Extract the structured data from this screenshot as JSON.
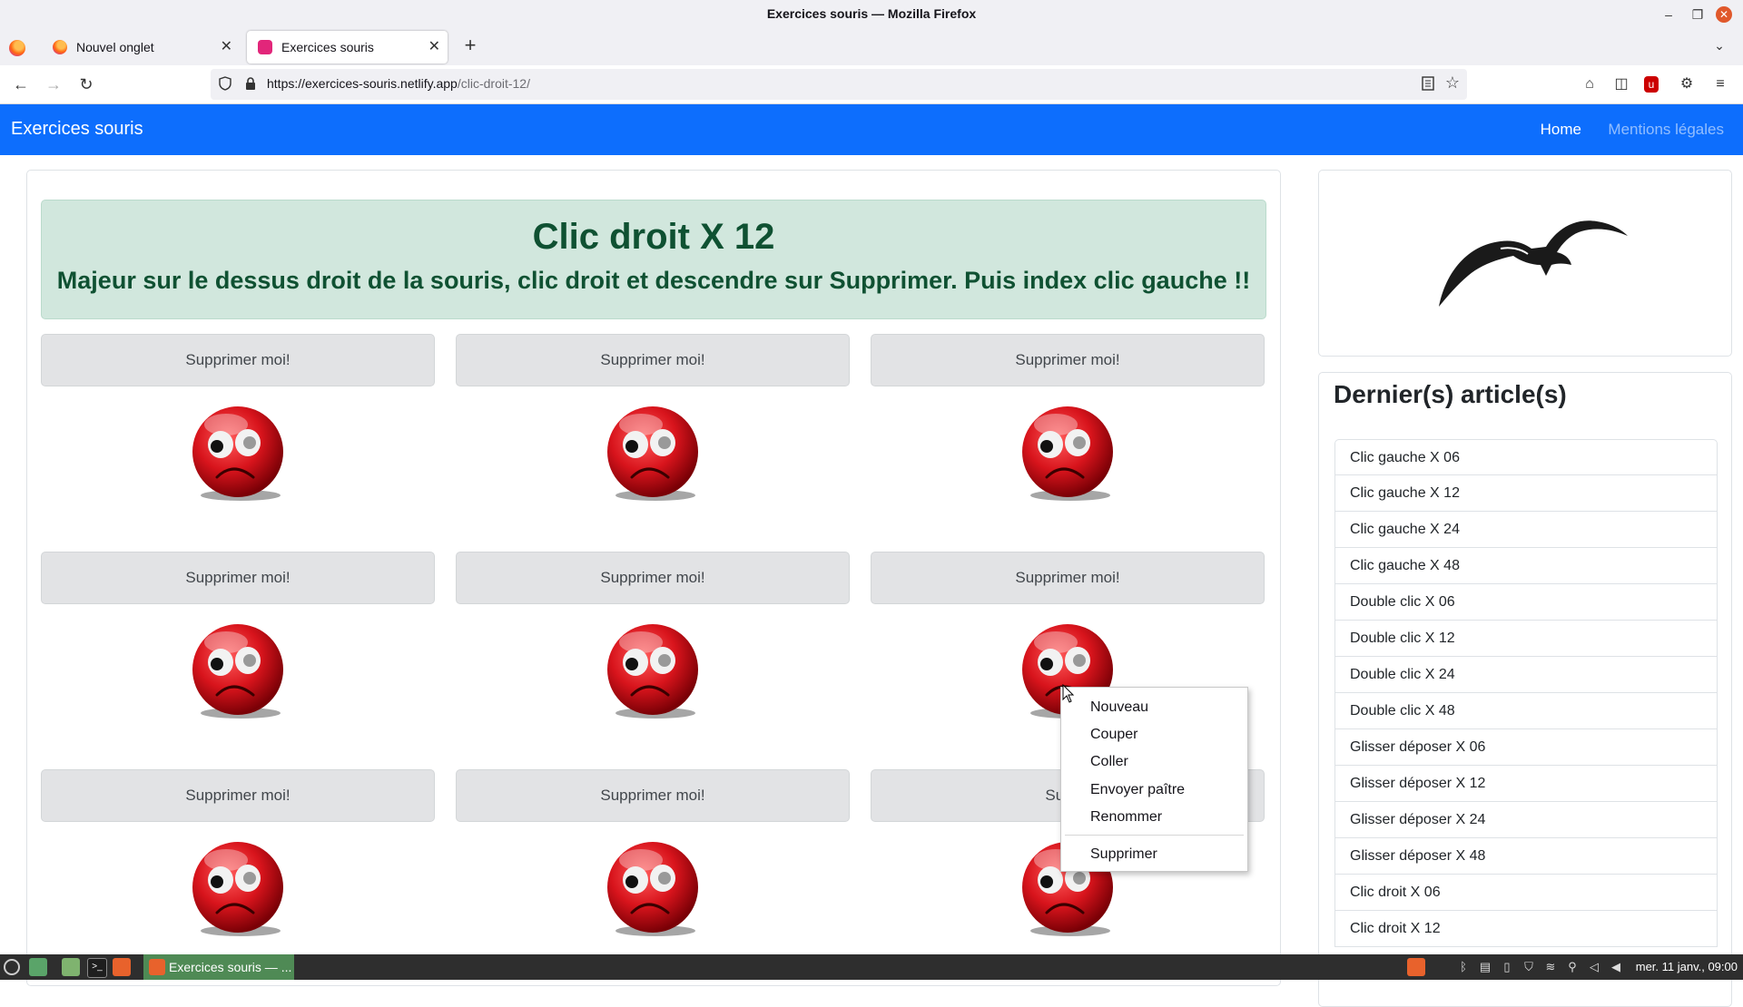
{
  "window": {
    "title": "Exercices souris — Mozilla Firefox"
  },
  "tabs": [
    {
      "label": "Nouvel onglet",
      "active": false
    },
    {
      "label": "Exercices souris",
      "active": true
    }
  ],
  "address": {
    "host": "https://exercices-souris.netlify.app",
    "path": "/clic-droit-12/"
  },
  "site": {
    "brand": "Exercices souris",
    "nav": {
      "home": "Home",
      "legal": "Mentions légales"
    }
  },
  "exercise": {
    "title": "Clic droit X 12",
    "instruction": "Majeur sur le dessus droit de la souris, clic droit et descendre sur Supprimer. Puis index clic gauche !!",
    "buttons": [
      "Supprimer moi!",
      "Supprimer moi!",
      "Supprimer moi!",
      "Supprimer moi!",
      "Supprimer moi!",
      "Supprimer moi!",
      "Supprimer moi!",
      "Supprimer moi!",
      "Suppri"
    ]
  },
  "sidebar": {
    "articles_title": "Dernier(s) article(s)",
    "articles": [
      "Clic gauche X 06",
      "Clic gauche X 12",
      "Clic gauche X 24",
      "Clic gauche X 48",
      "Double clic X 06",
      "Double clic X 12",
      "Double clic X 24",
      "Double clic X 48",
      "Glisser déposer X 06",
      "Glisser déposer X 12",
      "Glisser déposer X 24",
      "Glisser déposer X 48",
      "Clic droit X 06",
      "Clic droit X 12"
    ]
  },
  "context_menu": {
    "items": [
      "Nouveau",
      "Couper",
      "Coller",
      "Envoyer paître",
      "Renommer"
    ],
    "delete": "Supprimer"
  },
  "taskbar": {
    "task_label": "Exercices souris — ...",
    "clock": "mer. 11 janv., 09:00"
  },
  "colors": {
    "brand_blue": "#0d6efd",
    "alert_bg": "#d1e7dd",
    "alert_text": "#0f5132",
    "face_red": "#d8141c"
  }
}
